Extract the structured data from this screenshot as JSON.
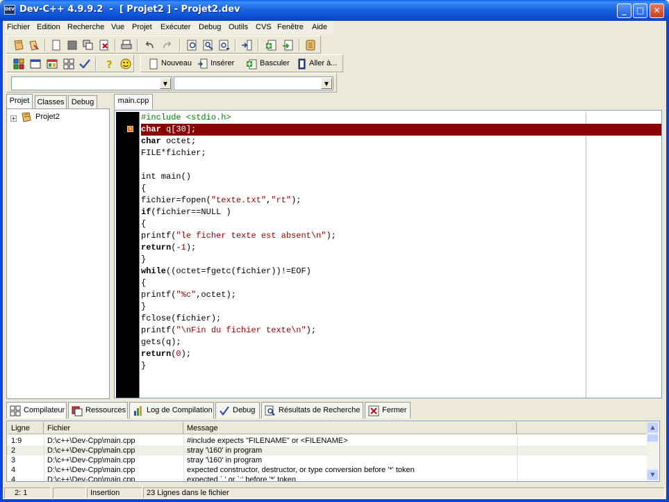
{
  "window": {
    "title": "Dev-C++ 4.9.9.2  -  [ Projet2 ] - Projet2.dev",
    "icon_text": "DEV",
    "icons": {
      "app": "devcpp-icon",
      "minimize": "minimize-icon",
      "maximize": "maximize-icon",
      "close": "close-icon"
    }
  },
  "menu": {
    "items": [
      "Fichier",
      "Edition",
      "Recherche",
      "Vue",
      "Projet",
      "Exécuter",
      "Debug",
      "Outils",
      "CVS",
      "Fenêtre",
      "Aide"
    ]
  },
  "toolbar2": {
    "nouveau": "Nouveau",
    "inserer": "Insérer",
    "basculer": "Basculer",
    "aller": "Aller à..."
  },
  "left_tabs": [
    "Projet",
    "Classes",
    "Debug"
  ],
  "project_tree": {
    "root": "Projet2",
    "expander": "+"
  },
  "editor": {
    "file_tab": "main.cpp",
    "error_line_index": 1,
    "lines": [
      [
        {
          "t": "#include <stdio.h>",
          "c": "pp"
        }
      ],
      [
        {
          "t": "char",
          "c": "kw"
        },
        {
          "t": " q[30];",
          "c": ""
        }
      ],
      [
        {
          "t": "char",
          "c": "kw"
        },
        {
          "t": " octet;",
          "c": ""
        }
      ],
      [
        {
          "t": "FILE*fichier;",
          "c": ""
        }
      ],
      [
        {
          "t": "",
          "c": ""
        }
      ],
      [
        {
          "t": "int main()",
          "c": ""
        }
      ],
      [
        {
          "t": "{",
          "c": ""
        }
      ],
      [
        {
          "t": "fichier=fopen(",
          "c": ""
        },
        {
          "t": "\"texte.txt\"",
          "c": "str"
        },
        {
          "t": ",",
          "c": ""
        },
        {
          "t": "\"rt\"",
          "c": "str"
        },
        {
          "t": ");",
          "c": ""
        }
      ],
      [
        {
          "t": "if",
          "c": "kw"
        },
        {
          "t": "(fichier==NULL )",
          "c": ""
        }
      ],
      [
        {
          "t": "{",
          "c": ""
        }
      ],
      [
        {
          "t": "printf(",
          "c": ""
        },
        {
          "t": "\"le ficher texte est absent\\n\"",
          "c": "str"
        },
        {
          "t": ");",
          "c": ""
        }
      ],
      [
        {
          "t": "return",
          "c": "kw"
        },
        {
          "t": "(-",
          "c": ""
        },
        {
          "t": "1",
          "c": "num"
        },
        {
          "t": ");",
          "c": ""
        }
      ],
      [
        {
          "t": "}",
          "c": ""
        }
      ],
      [
        {
          "t": "while",
          "c": "kw"
        },
        {
          "t": "((octet=fgetc(fichier))!=EOF)",
          "c": ""
        }
      ],
      [
        {
          "t": "{",
          "c": ""
        }
      ],
      [
        {
          "t": "printf(",
          "c": ""
        },
        {
          "t": "\"%c\"",
          "c": "str"
        },
        {
          "t": ",octet);",
          "c": ""
        }
      ],
      [
        {
          "t": "}",
          "c": ""
        }
      ],
      [
        {
          "t": "fclose(fichier);",
          "c": ""
        }
      ],
      [
        {
          "t": "printf(",
          "c": ""
        },
        {
          "t": "\"\\nFin du fichier texte\\n\"",
          "c": "str"
        },
        {
          "t": ");",
          "c": ""
        }
      ],
      [
        {
          "t": "gets(q);",
          "c": ""
        }
      ],
      [
        {
          "t": "return",
          "c": "kw"
        },
        {
          "t": "(",
          "c": ""
        },
        {
          "t": "0",
          "c": "num"
        },
        {
          "t": ");",
          "c": ""
        }
      ],
      [
        {
          "t": "}",
          "c": ""
        }
      ]
    ]
  },
  "bottom_tabs": [
    {
      "label": "Compilateur",
      "icon": "compiler-icon"
    },
    {
      "label": "Ressources",
      "icon": "resources-icon"
    },
    {
      "label": "Log de Compilation",
      "icon": "chart-icon"
    },
    {
      "label": "Debug",
      "icon": "check-icon"
    },
    {
      "label": "Résultats de Recherche",
      "icon": "search-results-icon"
    },
    {
      "label": "Fermer",
      "icon": "close-panel-icon"
    }
  ],
  "results": {
    "headers": [
      "Ligne",
      "Fichier",
      "Message"
    ],
    "rows": [
      [
        "1:9",
        "D:\\c++\\Dev-Cpp\\main.cpp",
        "#include expects \"FILENAME\" or <FILENAME>"
      ],
      [
        "2",
        "D:\\c++\\Dev-Cpp\\main.cpp",
        "stray '\\160' in program"
      ],
      [
        "3",
        "D:\\c++\\Dev-Cpp\\main.cpp",
        "stray '\\160' in program"
      ],
      [
        "4",
        "D:\\c++\\Dev-Cpp\\main.cpp",
        "expected constructor, destructor, or type conversion before '*' token"
      ],
      [
        "4",
        "D:\\c++\\Dev-Cpp\\main.cpp",
        "expected `,' or `;' before '*' token"
      ]
    ]
  },
  "status": {
    "position": "2: 1",
    "empty": "",
    "mode": "Insertion",
    "lines": "23 Lignes dans le fichier"
  },
  "colors": {
    "error_line": "#8b0000",
    "string": "#a00000",
    "preprocessor": "#008000"
  }
}
